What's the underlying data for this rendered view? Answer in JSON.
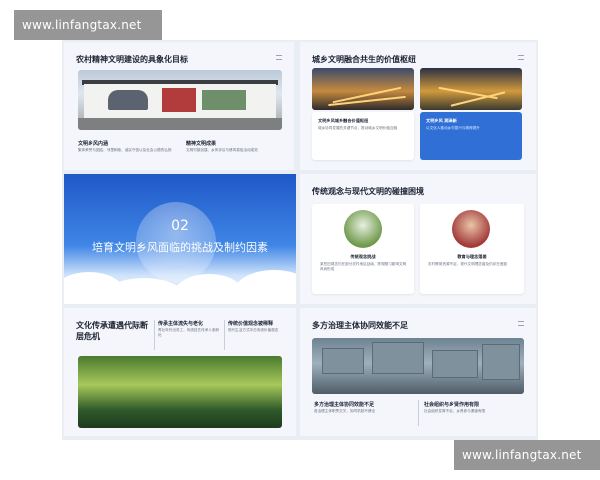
{
  "watermark": {
    "top": "www.linfangtax.net",
    "bottom": "www.linfangtax.net"
  },
  "panel1": {
    "title": "农村精神文明建设的具象化目标",
    "col1_title": "文明乡风内涵",
    "col1_text": "集体荣誉与团结、邻里和睦、诚实守信以及社会公德的弘扬",
    "col2_title": "精神文明成果",
    "col2_text": "文明村镇创建、乡风评议与移风易俗活动成效"
  },
  "panel2": {
    "title": "城乡文明融合共生的价值枢纽",
    "card1_title": "文明乡风城乡融合价值枢纽",
    "card1_text": "城乡协同发展的关键节点，推动城乡文明价值互融",
    "card2_title": "文明乡风 润泽新",
    "card2_text": "以文化人推动乡村振兴与精神提升"
  },
  "panel3": {
    "number": "02",
    "title": "培育文明乡风面临的挑战及制约因素"
  },
  "panel4": {
    "title": "传统观念与现代文明的碰撞困境",
    "card1_title": "传统观念挑战",
    "card1_text": "某些旧观念仍在部分农村地区延续，陈规陋习影响文明风尚形成",
    "card2_title": "教育与理念落差",
    "card2_text": "农村教育资源不足，现代文明理念普及仍存在差距"
  },
  "panel5": {
    "title": "文化传承遭遇代际断层危机",
    "col1_title": "传承主体流失与老化",
    "col1_text": "青壮年外出务工，传统技艺传承人老龄化",
    "col2_title": "传统价值观念被稀释",
    "col2_text": "现代生活方式冲击传统价值观念"
  },
  "panel6": {
    "title": "多方治理主体协同效能不足",
    "col1_title": "多方治理主体协同效能不足",
    "col1_text": "各治理主体职责交叉，协同机制不健全",
    "col2_title": "社会组织与乡贤作用有限",
    "col2_text": "社会组织发育不足，乡贤参与渠道有限"
  },
  "colors": {
    "accent_blue": "#2f6fd6",
    "board_bg": "#e9edf4"
  }
}
